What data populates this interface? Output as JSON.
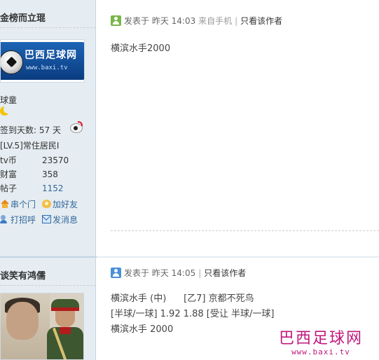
{
  "post1": {
    "author": "金榜而立琨",
    "avatar_text_cn": "巴西足球网",
    "avatar_text_en": "www.baxi.tv",
    "rank": "球童",
    "signin": "签到天数: 57 天",
    "level": "[LV.5]常住居民I",
    "stats": [
      {
        "key": "tv币",
        "value": "23570"
      },
      {
        "key": "财富",
        "value": "358"
      },
      {
        "key": "帖子",
        "value": "1152"
      }
    ],
    "actions": {
      "visit": "串个门",
      "add_friend": "加好友",
      "greet": "打招呼",
      "message": "发消息"
    },
    "meta": {
      "posted_label": "发表于",
      "time": "昨天 14:03",
      "source": "来自手机",
      "only_author": "只看该作者"
    },
    "body_lines": [
      "横滨水手2000"
    ],
    "icon_color": "#7ab648"
  },
  "post2": {
    "author": "谈笑有鸿儒",
    "meta": {
      "posted_label": "发表于",
      "time": "昨天 14:05",
      "only_author": "只看该作者"
    },
    "body_lines": [
      "横滨水手 (中)      [乙7] 京都不死鸟",
      "[半球/一球] 1.92 1.88 [受让 半球/一球]",
      "横滨水手 2000"
    ],
    "icon_color": "#4a90d9"
  },
  "watermark": {
    "cn": "巴西足球网",
    "en": "www.baxi.tv"
  }
}
